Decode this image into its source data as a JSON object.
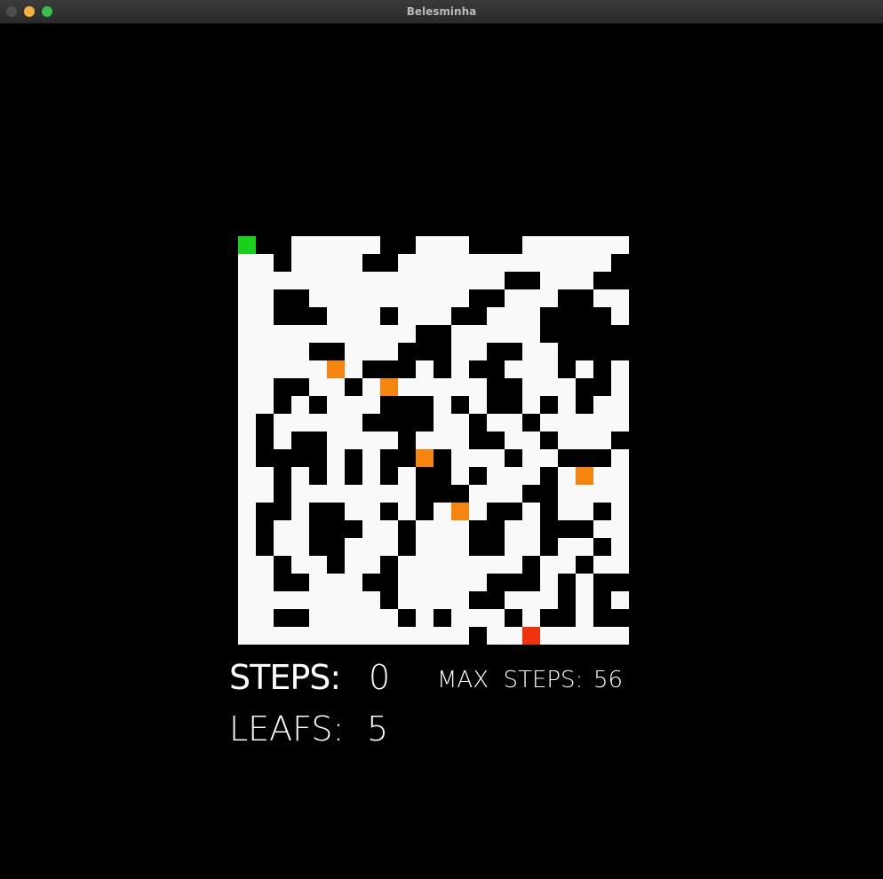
{
  "window": {
    "title": "Belesminha",
    "controls": [
      {
        "name": "close",
        "color": "#4d4d4d"
      },
      {
        "name": "minimize",
        "color": "#f5b23b"
      },
      {
        "name": "maximize",
        "color": "#34c14c"
      }
    ]
  },
  "colors": {
    "background": "#000000",
    "floor": "#f9f9f9",
    "wall": "#000000",
    "player": "#19d118",
    "leaf": "#f5850e",
    "goal": "#f0330c"
  },
  "maze": {
    "columns": 22,
    "rows": 23,
    "grid": [
      "P##.....##...###......",
      "..#....##............#",
      "...............##...##",
      "..##.........##...##..",
      "..###...#...##...####.",
      "..........##.....#####",
      "....##...###..##..####",
      ".......###.#.##...#.#.",
      "..##..#.......##...##.",
      "..#.#...###.#.##.#.#..",
      ".#.....####..#..#.....",
      ".#.##....#...##..#...#",
      ".####.#.##.#...#..###.",
      "..#.#.#.#.##.#...#....",
      "..#.......###...##....",
      ".##.##..#.#.#.##.#..#.",
      ".#..###..#...##..###..",
      ".#..##...#...##..#..#.",
      "..#..#..#.......#..#..",
      "..##...##.....###.#.##",
      "........#....##...#.#.",
      "..##.....#.#...#.##.##",
      ".............#..G.....",
      "##........#.##..##..#."
    ],
    "legend": {
      "#": "wall",
      ".": "floor",
      "P": "player",
      "L": "leaf",
      "G": "goal"
    }
  },
  "hud": {
    "steps_label": "STEPS:",
    "steps_value": "0",
    "max_steps_label": "MAX  STEPS:",
    "max_steps_value": "56",
    "leafs_label": "LEAFS:",
    "leafs_value": "5"
  }
}
